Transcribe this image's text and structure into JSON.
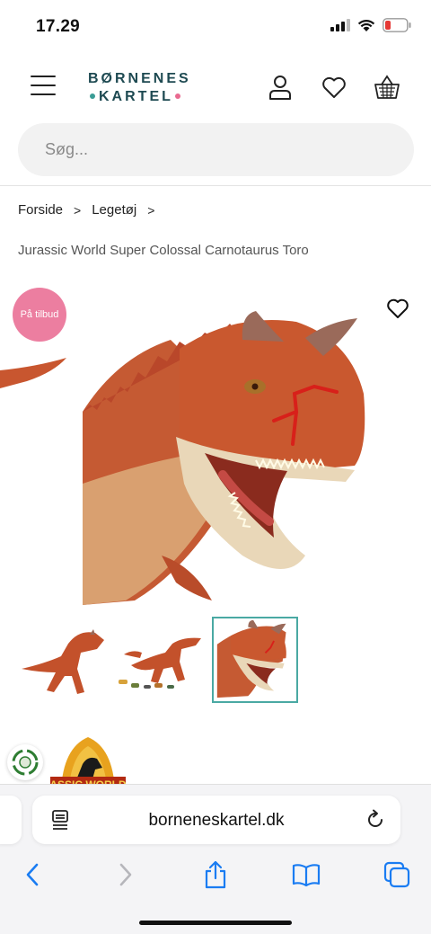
{
  "status_bar": {
    "time": "17.29"
  },
  "header": {
    "logo_top": "BØRNENES",
    "logo_bottom": "KARTEL"
  },
  "search": {
    "placeholder": "Søg..."
  },
  "breadcrumb": {
    "items": [
      "Forside",
      "Legetøj"
    ],
    "separator": ">"
  },
  "product": {
    "title": "Jurassic World Super Colossal Carnotaurus Toro",
    "badge": "På tilbud",
    "thumbnails_count": 3,
    "active_thumbnail": 3
  },
  "brand_logo_text": "ASSIC WORLD",
  "browser": {
    "url": "borneneskartel.dk"
  },
  "colors": {
    "brand_teal": "#1e4a52",
    "accent_teal": "#4aa9a3",
    "badge_pink": "#ec7ea0",
    "dino_orange": "#c8562f"
  }
}
